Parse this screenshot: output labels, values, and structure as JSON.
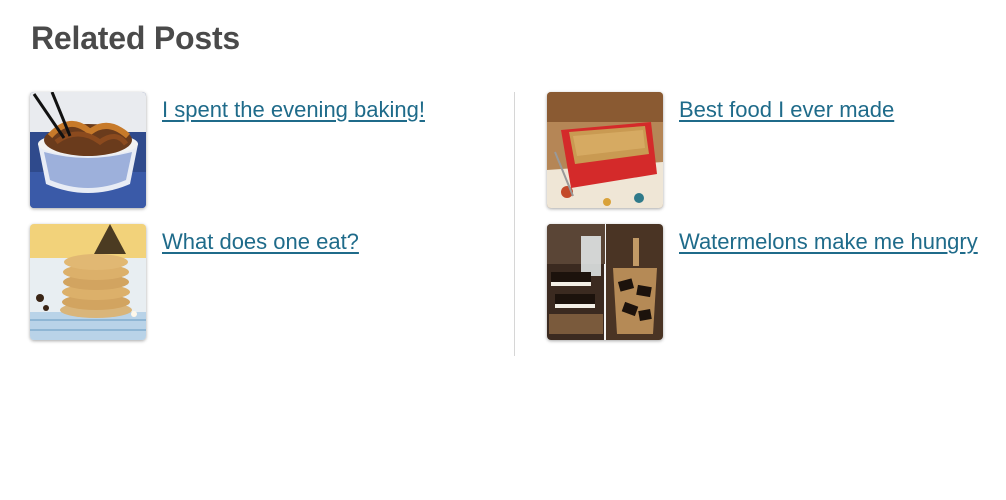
{
  "related": {
    "heading": "Related Posts",
    "posts": [
      {
        "title": "I spent the evening baking!",
        "image": "noodle-bowl-photo"
      },
      {
        "title": "Best food I ever made",
        "image": "casserole-dish-photo"
      },
      {
        "title": "What does one eat?",
        "image": "cookie-stack-photo"
      },
      {
        "title": "Watermelons make me hungry",
        "image": "chocolate-bars-photo"
      }
    ]
  },
  "colors": {
    "heading": "#4a4a4a",
    "link": "#1f6b8a",
    "divider": "#d6d6d6",
    "background": "#ffffff"
  }
}
